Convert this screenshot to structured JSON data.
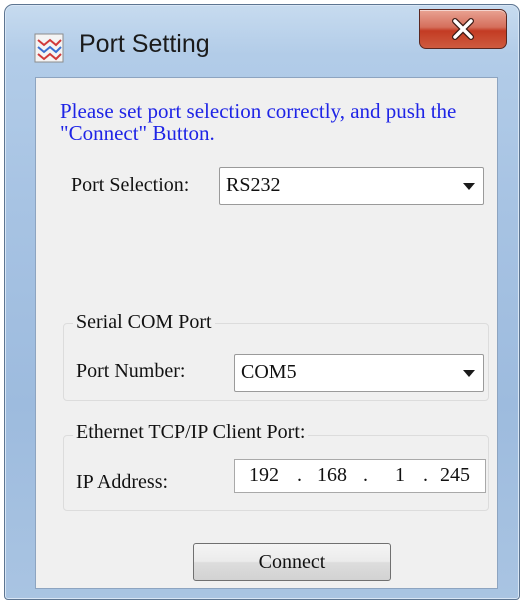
{
  "window": {
    "title": "Port Setting",
    "icon": "app-icon",
    "close_icon": "close-icon"
  },
  "instructions": "Please set port selection correctly, and push the \"Connect\" Button.",
  "port_selection": {
    "label": "Port Selection:",
    "value": "RS232"
  },
  "serial_group": {
    "title": "Serial COM Port",
    "port_number_label": "Port Number:",
    "port_number_value": "COM5"
  },
  "ethernet_group": {
    "title": "Ethernet TCP/IP Client Port:",
    "ip_label": "IP Address:",
    "ip_octets": [
      "192",
      "168",
      "1",
      "245"
    ]
  },
  "connect_label": "Connect",
  "colors": {
    "instruction_text": "#1e24e6",
    "close_button": "#c33b23"
  }
}
